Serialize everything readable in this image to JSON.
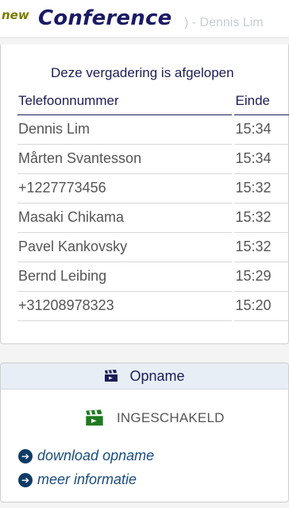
{
  "app": {
    "logo_prefix": "new",
    "logo_name": "Conference",
    "header_behind_text": ") - Dennis Lim"
  },
  "calls": {
    "status_title": "Deze vergadering is afgelopen",
    "columns": {
      "phone": "Telefoonnummer",
      "end": "Einde"
    },
    "rows": [
      {
        "name": "Dennis Lim",
        "end": "15:34"
      },
      {
        "name": "Mårten Svantesson",
        "end": "15:34"
      },
      {
        "name": "+1227773456",
        "end": "15:32"
      },
      {
        "name": "Masaki Chikama",
        "end": "15:32"
      },
      {
        "name": "Pavel Kankovsky",
        "end": "15:32"
      },
      {
        "name": "Bernd Leibing",
        "end": "15:29"
      },
      {
        "name": "+31208978323",
        "end": "15:20"
      }
    ]
  },
  "recording": {
    "title": "Opname",
    "status": "INGESCHAKELD",
    "status_icon": "clapperboard-icon",
    "status_icon_color": "#1f7a1f",
    "links": [
      {
        "label": "download opname",
        "icon": "arrow-circle-right-icon"
      },
      {
        "label": "meer informatie",
        "icon": "arrow-circle-right-icon"
      }
    ]
  }
}
